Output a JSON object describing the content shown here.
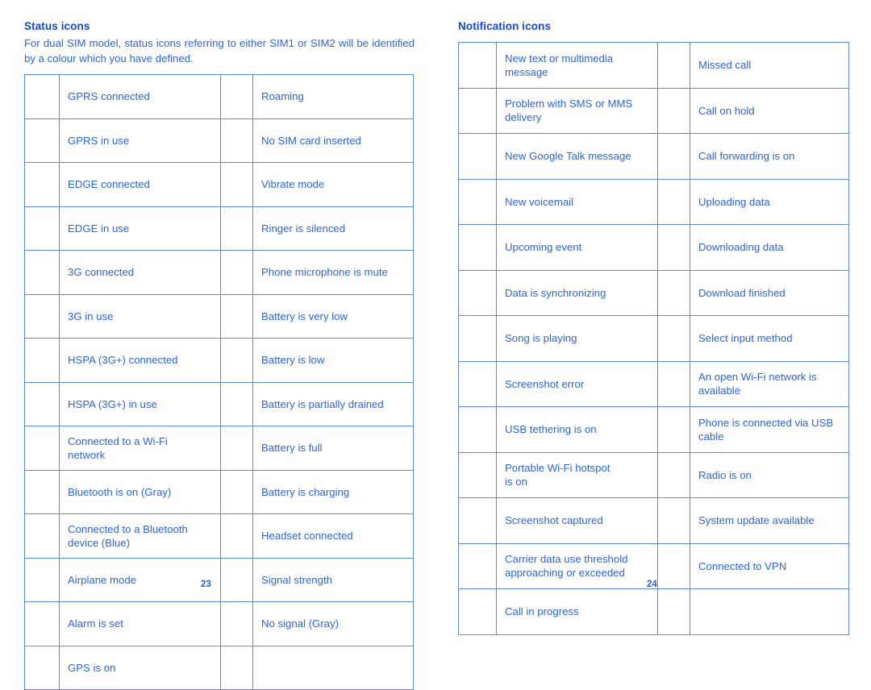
{
  "left_page": {
    "heading": "Status icons",
    "intro": "For dual SIM model, status icons referring to either SIM1 or SIM2 will be identified by a colour which you have defined.",
    "page_number": "23",
    "table": {
      "rows": [
        {
          "label_a": "GPRS connected",
          "label_b": "Roaming"
        },
        {
          "label_a": "GPRS in use",
          "label_b": "No SIM card inserted"
        },
        {
          "label_a": "EDGE connected",
          "label_b": "Vibrate mode"
        },
        {
          "label_a": "EDGE in use",
          "label_b": "Ringer is silenced"
        },
        {
          "label_a": "3G connected",
          "label_b": "Phone microphone is mute"
        },
        {
          "label_a": "3G in use",
          "label_b": "Battery is very low"
        },
        {
          "label_a": "HSPA (3G+) connected",
          "label_b": "Battery is low"
        },
        {
          "label_a": "HSPA (3G+) in use",
          "label_b": "Battery is partially drained"
        },
        {
          "label_a": "Connected to a Wi-Fi\nnetwork",
          "label_b": "Battery is full"
        },
        {
          "label_a": "Bluetooth is on (Gray)",
          "label_b": "Battery is charging"
        },
        {
          "label_a": "Connected to a Bluetooth\ndevice (Blue)",
          "label_b": "Headset connected"
        },
        {
          "label_a": "Airplane mode",
          "label_b": "Signal strength"
        },
        {
          "label_a": "Alarm is set",
          "label_b": "No signal (Gray)"
        },
        {
          "label_a": "GPS is on",
          "label_b": ""
        }
      ]
    }
  },
  "right_page": {
    "heading": "Notification icons",
    "page_number": "24",
    "table": {
      "rows": [
        {
          "label_a": "New text or multimedia\nmessage",
          "label_b": "Missed call"
        },
        {
          "label_a": "Problem with SMS or MMS\ndelivery",
          "label_b": "Call on hold"
        },
        {
          "label_a": "New Google Talk message",
          "label_b": "Call forwarding is on"
        },
        {
          "label_a": "New voicemail",
          "label_b": "Uploading data"
        },
        {
          "label_a": "Upcoming event",
          "label_b": "Downloading data"
        },
        {
          "label_a": "Data is synchronizing",
          "label_b": "Download finished"
        },
        {
          "label_a": "Song is playing",
          "label_b": "Select input method"
        },
        {
          "label_a": "Screenshot error",
          "label_b": "An open Wi-Fi network is\navailable"
        },
        {
          "label_a": "USB tethering is on",
          "label_b": "Phone is connected via USB\ncable"
        },
        {
          "label_a": "Portable Wi-Fi hotspot\nis on",
          "label_b": "Radio is on"
        },
        {
          "label_a": "Screenshot captured",
          "label_b": "System update available"
        },
        {
          "label_a": "Carrier data use threshold\napproaching or exceeded",
          "label_b": "Connected to VPN"
        },
        {
          "label_a": "Call in progress",
          "label_b": ""
        }
      ]
    }
  },
  "colors": {
    "text_blue": "#2d63e0",
    "heading_blue": "#1347cf",
    "border_blue": "#2a5fd9",
    "grid_blue": "#5e86e8"
  }
}
